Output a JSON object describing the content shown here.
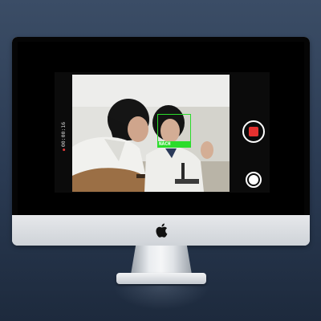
{
  "camera": {
    "recording_time": "00:00:16",
    "face_label": "NACH",
    "colors": {
      "face_box": "#2bdc2b",
      "record": "#e4312f",
      "recording_dot": "#e23b3b"
    }
  },
  "device": {
    "logo_icon": "apple-logo-icon"
  }
}
